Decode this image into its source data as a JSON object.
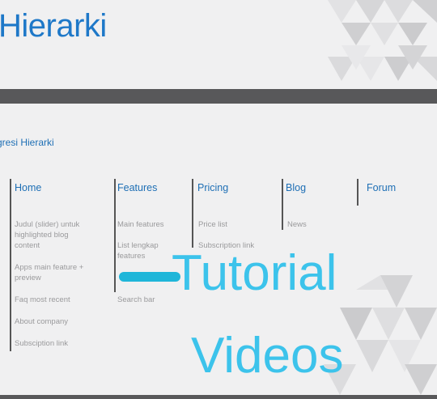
{
  "header": {
    "title": "Hierarki"
  },
  "subtitle": "gresi Hierarki",
  "columns": [
    {
      "heading": "Home",
      "items": [
        "Judul (slider) untuk highlighted blog content",
        "Apps  main feature + preview",
        "Faq most recent",
        "About company",
        "Subsciption link"
      ]
    },
    {
      "heading": "Features",
      "items": [
        "Main features",
        "List lengkap features",
        "download",
        "Search bar"
      ]
    },
    {
      "heading": "Pricing",
      "items": [
        "Price list",
        "Subscription link"
      ]
    },
    {
      "heading": "Blog",
      "items": [
        "News"
      ]
    },
    {
      "heading": "Forum",
      "items": []
    }
  ],
  "overlay": {
    "line1": "Tutorial",
    "line2": "Videos"
  },
  "colors": {
    "title": "#1e78c8",
    "bar": "#58585a",
    "overlay_text": "#3cc3eb",
    "highlight": "#1fb6d9"
  }
}
